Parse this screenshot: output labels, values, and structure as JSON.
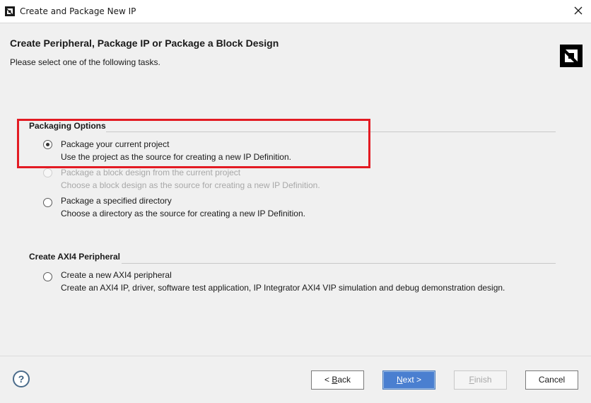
{
  "window": {
    "title": "Create and Package New IP"
  },
  "header": {
    "title": "Create Peripheral, Package IP or Package a Block Design",
    "subtitle": "Please select one of the following tasks."
  },
  "sections": {
    "packaging": {
      "title": "Packaging Options",
      "options": [
        {
          "label": "Package your current project",
          "description": "Use the project as the source for creating a new IP Definition.",
          "selected": true,
          "enabled": true
        },
        {
          "label": "Package a block design from the current project",
          "description": "Choose a block design as the source for creating a new IP Definition.",
          "selected": false,
          "enabled": false
        },
        {
          "label": "Package a specified directory",
          "description": "Choose a directory as the source for creating a new IP Definition.",
          "selected": false,
          "enabled": true
        }
      ]
    },
    "axi4": {
      "title": "Create AXI4 Peripheral",
      "options": [
        {
          "label": "Create a new AXI4 peripheral",
          "description": "Create an AXI4 IP, driver, software test application, IP Integrator AXI4 VIP simulation and debug demonstration design.",
          "selected": false,
          "enabled": true
        }
      ]
    }
  },
  "footer": {
    "help_label": "?",
    "back_prefix": "< ",
    "back_key": "B",
    "back_rest": "ack",
    "next_key": "N",
    "next_rest": "ext >",
    "finish_key": "F",
    "finish_rest": "inish",
    "cancel_label": "Cancel"
  },
  "colors": {
    "highlight": "#e31b23",
    "primary_button": "#4a7fd0",
    "background": "#f0f0f0"
  },
  "icons": {
    "app": "amd-logo-icon",
    "close": "close-icon",
    "brand": "amd-logo-icon",
    "help": "help-icon"
  }
}
